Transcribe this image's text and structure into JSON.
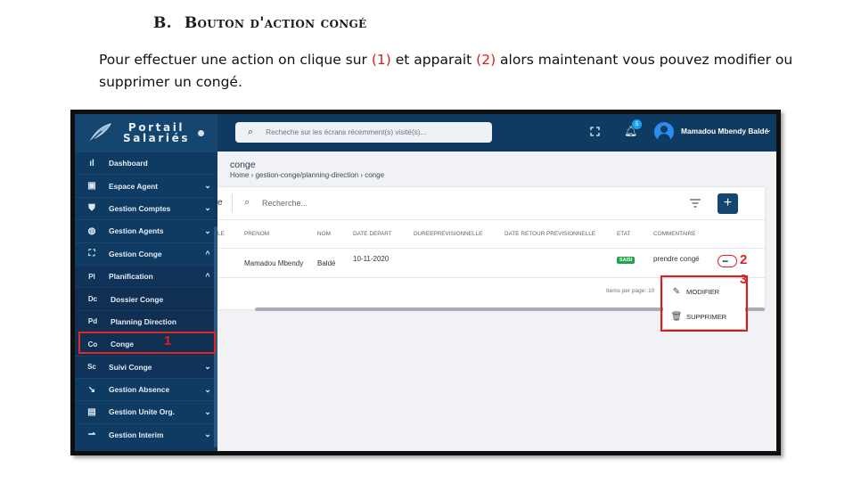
{
  "doc": {
    "heading_num": "B.",
    "heading_text": "Bouton d'action congé",
    "intro_1": "Pour effectuer une action on clique sur ",
    "intro_ref1": "(1)",
    "intro_2": " et apparait ",
    "intro_ref2": "(2)",
    "intro_3": " alors maintenant vous pouvez modifier ou supprimer un congé."
  },
  "callouts": {
    "one": "1",
    "two": "2",
    "three": "3"
  },
  "colors": {
    "sidebar": "#0f3b63",
    "accent": "#15466f",
    "callout": "#e02020",
    "etat_badge": "#20a349"
  },
  "brand": {
    "line1": "Portail",
    "line2": "Salariés",
    "logo_icon": "feather-icon"
  },
  "sidebar": {
    "items": [
      {
        "icon": "ıl",
        "label": "Dashboard",
        "chev": ""
      },
      {
        "icon": "▣",
        "label": "Espace Agent",
        "chev": "⌄"
      },
      {
        "icon": "⛊",
        "label": "Gestion Comptes",
        "chev": "⌄"
      },
      {
        "icon": "◍",
        "label": "Gestion Agents",
        "chev": "⌄"
      },
      {
        "icon": "⛶",
        "label": "Gestion Conge",
        "chev": "^"
      },
      {
        "icon": "Pl",
        "label": "Planification",
        "chev": "^"
      },
      {
        "icon": "Dc",
        "label": "Dossier Conge",
        "chev": ""
      },
      {
        "icon": "Pd",
        "label": "Planning Direction",
        "chev": ""
      },
      {
        "icon": "Co",
        "label": "Conge",
        "chev": ""
      },
      {
        "icon": "Sc",
        "label": "Suivi Conge",
        "chev": "⌄"
      },
      {
        "icon": "↘",
        "label": "Gestion Absence",
        "chev": "⌄"
      },
      {
        "icon": "▤",
        "label": "Gestion Unite Org.",
        "chev": "⌄"
      },
      {
        "icon": "⇀",
        "label": "Gestion Interim",
        "chev": "⌄"
      }
    ]
  },
  "topbar": {
    "search_placeholder": "Recheche sur les écrans récemment(s) visité(s)...",
    "notif_count": "5",
    "user_name": "Mamadou Mbendy Baldé"
  },
  "content": {
    "title": "conge",
    "breadcrumb": [
      "Home",
      "gestion-conge/planning-direction",
      "conge"
    ],
    "search_placeholder": "Recherche...",
    "toolbar_edge": "e",
    "add_label": "+",
    "columns": [
      "LE",
      "PRENOM",
      "NOM",
      "DATE DEPART",
      "DUREEPREVISIONNELLE",
      "DATE RETOUR PREVISIONNELLE",
      "ETAT",
      "COMMENTAIRE"
    ],
    "row": {
      "prenom": "Mamadou Mbendy",
      "nom": "Baldé",
      "date_depart": "10-11-2020",
      "etat": "SAISI",
      "commentaire": "prendre congé",
      "more": "..."
    },
    "pager_text": "Items per page: 10",
    "menu": [
      {
        "icon": "✎",
        "label": "MODIFIER"
      },
      {
        "icon": "🗑",
        "label": "SUPPRIMER"
      }
    ]
  }
}
